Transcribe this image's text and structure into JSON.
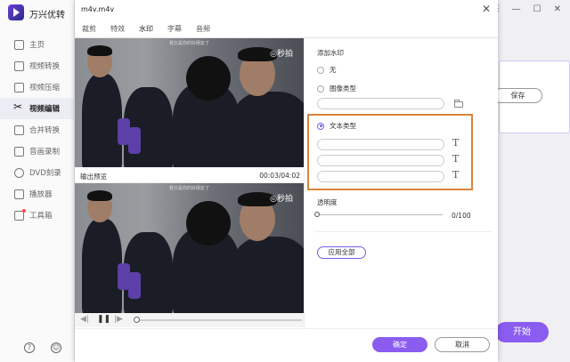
{
  "app": {
    "title": "万兴优转",
    "window_controls": [
      "☰",
      "—",
      "☐",
      "✕"
    ],
    "nav": [
      {
        "label": "主页",
        "icon": "home-icon"
      },
      {
        "label": "视频转换",
        "icon": "convert-icon"
      },
      {
        "label": "视频压缩",
        "icon": "compress-icon"
      },
      {
        "label": "视频编辑",
        "icon": "scissors-icon",
        "active": true
      },
      {
        "label": "合并转换",
        "icon": "merge-icon"
      },
      {
        "label": "音画录制",
        "icon": "record-icon"
      },
      {
        "label": "DVD刻录",
        "icon": "dvd-icon"
      },
      {
        "label": "播放器",
        "icon": "player-icon"
      },
      {
        "label": "工具箱",
        "icon": "toolbox-icon"
      }
    ],
    "bottom_icons": [
      "?",
      "☺"
    ],
    "background_save": "保存",
    "background_start": "开始"
  },
  "dialog": {
    "title": "m4v.m4v",
    "close": "✕",
    "tabs": [
      {
        "label": "裁剪"
      },
      {
        "label": "特效"
      },
      {
        "label": "水印",
        "active": true
      },
      {
        "label": "字幕"
      },
      {
        "label": "音频"
      }
    ],
    "preview_label": "输出预览",
    "timecode": "00:03/04:02",
    "video_watermark": "◎秒拍",
    "video_caption": "我又是你的好朋友了",
    "player_controls": [
      "◀|",
      "❚❚",
      "|▶"
    ],
    "settings": {
      "add_watermark_label": "添加水印",
      "options": [
        {
          "label": "无",
          "selected": false
        },
        {
          "label": "图像类型",
          "selected": false
        },
        {
          "label": "文本类型",
          "selected": true
        }
      ],
      "image_field_value": "",
      "text_field_values": [
        "",
        "",
        ""
      ],
      "text_icon_glyph": "T",
      "transparency_label": "透明度",
      "transparency_value": "0/100",
      "transparency_level": 0,
      "apply_all_label": "应用全部"
    },
    "ok_label": "确定",
    "cancel_label": "取消",
    "colors": {
      "accent": "#8a5cf0",
      "highlight": "#d9843a"
    }
  }
}
